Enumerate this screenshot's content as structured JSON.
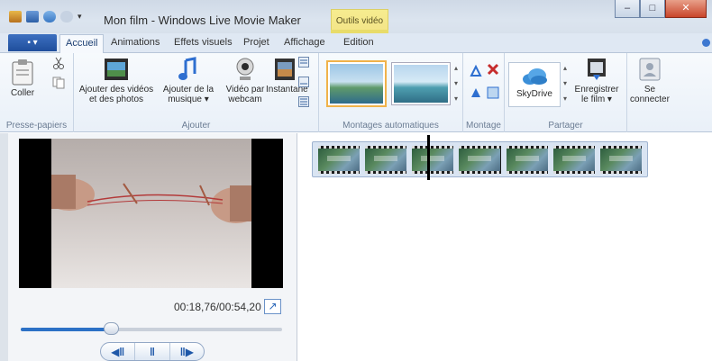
{
  "titlebar": {
    "title": "Mon film - Windows Live Movie Maker",
    "contextual_tab_group": "Outils vidéo",
    "window_controls": [
      "–",
      "□",
      "✕"
    ]
  },
  "tabs": {
    "app_menu_label": "▪ ▾",
    "items": [
      "Accueil",
      "Animations",
      "Effets visuels",
      "Projet",
      "Affichage",
      "Edition"
    ],
    "active": "Accueil"
  },
  "ribbon": {
    "groups": {
      "clipboard": "Presse-papiers",
      "add": "Ajouter",
      "auto_montage": "Montages automatiques",
      "montage": "Montage",
      "share": "Partager"
    },
    "buttons": {
      "paste": "Coller",
      "add_videos_line1": "Ajouter des vidéos",
      "add_videos_line2": "et des photos",
      "add_music_line1": "Ajouter de la",
      "add_music_line2": "musique ▾",
      "webcam_line1": "Vidéo par",
      "webcam_line2": "webcam",
      "snapshot": "Instantané",
      "skydrive": "SkyDrive",
      "save_movie_line1": "Enregistrer",
      "save_movie_line2": "le film ▾",
      "sign_in_line1": "Se",
      "sign_in_line2": "connecter"
    }
  },
  "preview": {
    "time": "00:18,76/00:54,20",
    "progress_fraction": 0.346,
    "buttons": [
      "◀‖",
      "‖",
      "‖▶"
    ]
  },
  "storyboard": {
    "clip_count": 7
  },
  "colors": {
    "accent": "#2c71c6",
    "contextual_tab": "#f3e487",
    "app_button": "#1f4e9c"
  }
}
